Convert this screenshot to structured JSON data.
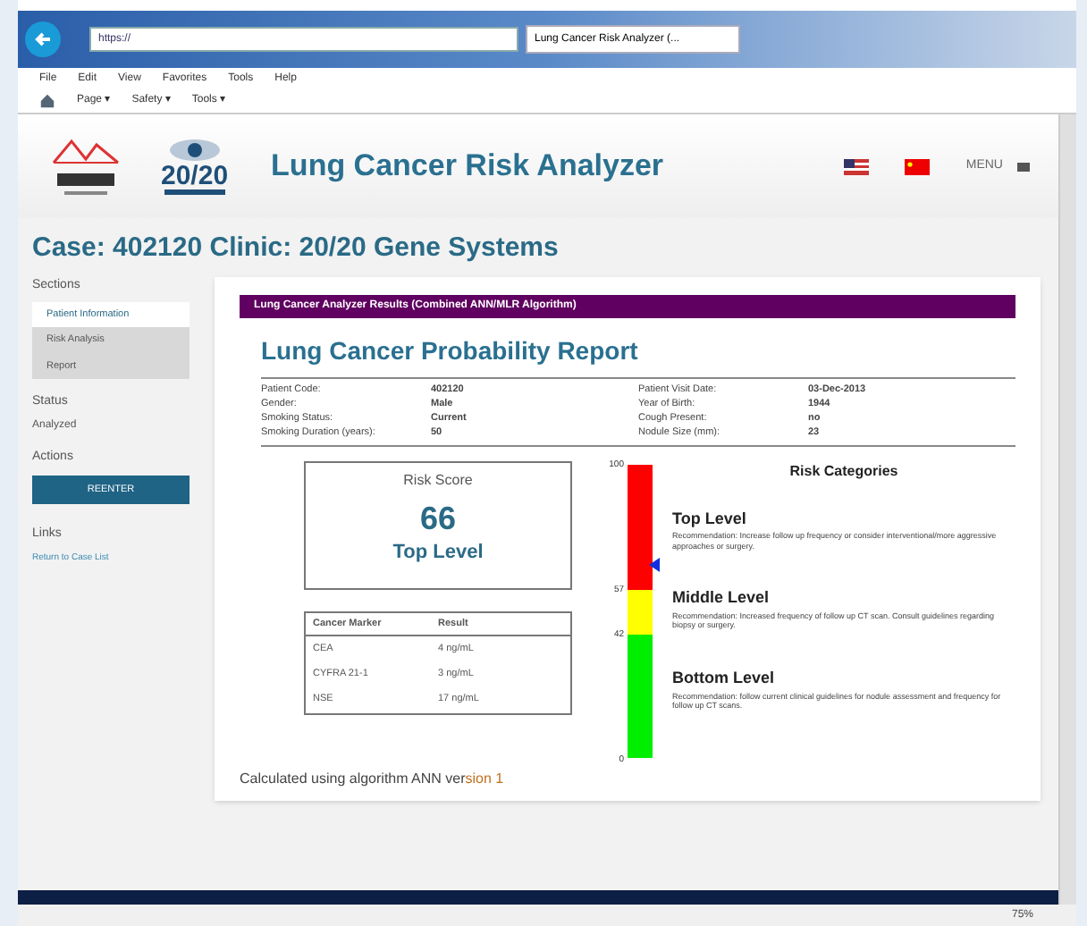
{
  "browser": {
    "address": "https://",
    "tab": "Lung Cancer Risk Analyzer (...",
    "menu": [
      "File",
      "Edit",
      "View",
      "Favorites",
      "Tools",
      "Help"
    ],
    "toolbar": [
      "Page ▾",
      "Safety ▾",
      "Tools ▾"
    ],
    "zoom": "75%"
  },
  "header": {
    "logo_text": "20/20",
    "title": "Lung Cancer Risk Analyzer",
    "menu": "MENU"
  },
  "case_title": "Case: 402120 Clinic: 20/20 Gene Systems",
  "sidebar": {
    "sections_label": "Sections",
    "items": [
      {
        "label": "Patient Information",
        "selected": true
      },
      {
        "label": "Risk Analysis",
        "selected": false
      },
      {
        "label": "Report",
        "selected": false
      }
    ],
    "status_label": "Status",
    "status": "Analyzed",
    "actions_label": "Actions",
    "action_button": "REENTER",
    "links_label": "Links",
    "link": "Return to Case List"
  },
  "report": {
    "banner": "Lung Cancer Analyzer Results (Combined ANN/MLR Algorithm)",
    "title": "Lung Cancer Probability Report",
    "fields_left": [
      {
        "label": "Patient Code:",
        "value": "402120"
      },
      {
        "label": "Gender:",
        "value": "Male"
      },
      {
        "label": "Smoking Status:",
        "value": "Current"
      },
      {
        "label": "Smoking Duration (years):",
        "value": "50"
      }
    ],
    "fields_right": [
      {
        "label": "Patient Visit Date:",
        "value": "03-Dec-2013"
      },
      {
        "label": "Year of Birth:",
        "value": "1944"
      },
      {
        "label": "Cough Present:",
        "value": "no"
      },
      {
        "label": "Nodule Size (mm):",
        "value": "23"
      }
    ],
    "score_label": "Risk Score",
    "score": "66",
    "score_level": "Top Level",
    "markers_columns": [
      "Cancer Marker",
      "Result"
    ],
    "markers": [
      [
        "CEA",
        "4 ng/mL"
      ],
      [
        "CYFRA 21-1",
        "3 ng/mL"
      ],
      [
        "NSE",
        "17 ng/mL"
      ]
    ],
    "gauge": {
      "ticks": [
        "100",
        "57",
        "42",
        "0"
      ]
    },
    "categories_title": "Risk Categories",
    "categories": [
      {
        "name": "Top Level",
        "text": "Recommendation: Increase follow up frequency or consider interventional/more aggressive approaches or surgery."
      },
      {
        "name": "Middle Level",
        "text": "Recommendation: Increased frequency of follow up CT scan. Consult guidelines regarding biopsy or surgery."
      },
      {
        "name": "Bottom Level",
        "text": "Recommendation: follow current clinical guidelines for nodule assessment and frequency for follow up CT scans."
      }
    ],
    "footnote_prefix": "Calculated using algorithm ANN ver",
    "footnote_suffix": "sion 1"
  }
}
